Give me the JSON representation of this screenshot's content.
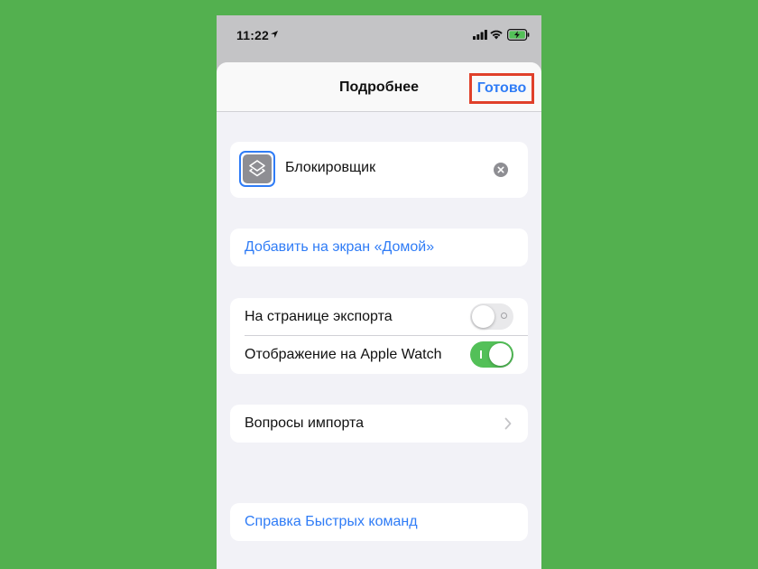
{
  "status_bar": {
    "time": "11:22"
  },
  "nav": {
    "title": "Подробнее",
    "done_label": "Готово"
  },
  "shortcut": {
    "name": "Блокировщик"
  },
  "actions": {
    "add_to_home": "Добавить на экран «Домой»",
    "import_questions": "Вопросы импорта",
    "help": "Справка Быстрых команд"
  },
  "toggles": [
    {
      "label": "На странице экспорта",
      "state": "off"
    },
    {
      "label": "Отображение на Apple Watch",
      "state": "on"
    }
  ],
  "colors": {
    "background": "#53b04f",
    "accent": "#2f7cf6",
    "highlight_border": "#e0402a",
    "switch_on": "#53c058",
    "switch_off": "#e9e9eb"
  },
  "icons": {
    "shortcut": "layers-icon",
    "clear": "clear-icon",
    "chevron": "chevron-right-icon"
  }
}
